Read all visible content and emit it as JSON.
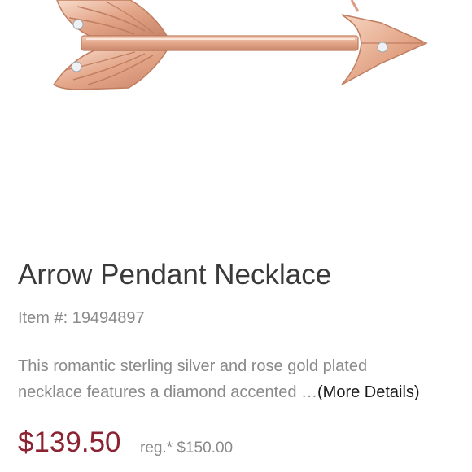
{
  "product": {
    "image_alt": "Arrow Pendant Necklace product photo (rose gold arrow with diamond accents)",
    "title": "Arrow Pendant Necklace",
    "item_number": "Item #: 19494897",
    "description_line1": "This romantic sterling silver and rose gold plated",
    "description_line2": "necklace features a diamond accented",
    "ellipsis": " …",
    "more_details_label": "(More Details)",
    "sale_price": "$139.50",
    "reg_price": "reg.* $150.00"
  },
  "colors": {
    "sale_price": "#8b2332",
    "metal_rose_gold": "#e8b39a",
    "text_gray": "#8a8a8a",
    "title": "#3a3a3a"
  },
  "icons": {
    "product_image": "arrow-pendant-image"
  }
}
